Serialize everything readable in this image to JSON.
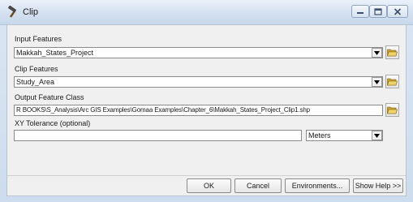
{
  "window": {
    "title": "Clip"
  },
  "form": {
    "input_features": {
      "label": "Input Features",
      "value": "Makkah_States_Project"
    },
    "clip_features": {
      "label": "Clip Features",
      "value": "Study_Area"
    },
    "output_feature_class": {
      "label": "Output Feature Class",
      "value": "R BOOKS\\S_Analysis\\Arc GIS Examples\\Gomaa Examples\\Chapter_6\\Makkah_States_Project_Clip1.shp"
    },
    "xy_tolerance": {
      "label": "XY Tolerance (optional)",
      "value": "",
      "unit": "Meters"
    }
  },
  "buttons": {
    "ok": "OK",
    "cancel": "Cancel",
    "environments": "Environments...",
    "show_help": "Show Help >>"
  },
  "icons": {
    "title": "hammer-icon",
    "browse": "open-folder-icon",
    "dropdown": "chevron-down-icon"
  },
  "colors": {
    "titlebar": "#d3e0f0",
    "client_bg": "#f0f0f0",
    "folder_yellow": "#e8c24a"
  }
}
